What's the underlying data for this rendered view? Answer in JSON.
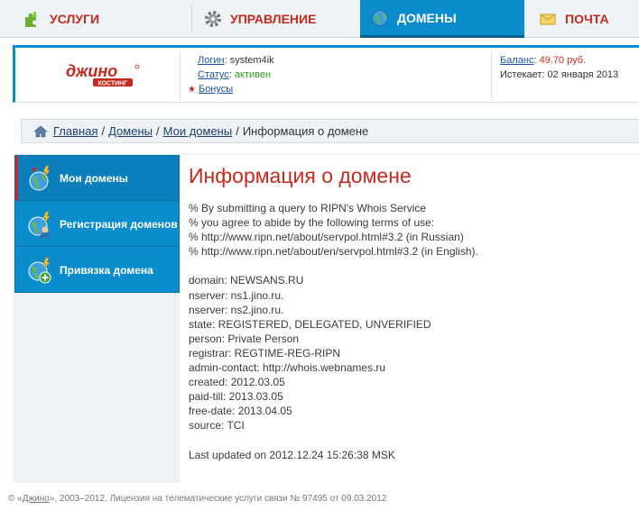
{
  "nav": {
    "tabs": [
      {
        "label": "Услуги",
        "icon": "puzzle-icon"
      },
      {
        "label": "Управление",
        "icon": "gear-icon"
      },
      {
        "label": "Домены",
        "icon": "globe-icon",
        "active": true
      },
      {
        "label": "Почта",
        "icon": "envelope-icon"
      }
    ]
  },
  "account": {
    "logo_text": "джино",
    "logo_sub": "хостинг",
    "login_label": "Логин",
    "login_value": "system4ik",
    "status_label": "Статус",
    "status_value": "активен",
    "bonus_label": "Бонусы",
    "balance_label": "Баланс",
    "balance_value": "49.70 руб.",
    "expires_label": "Истекает:",
    "expires_value": "02 января 2013"
  },
  "breadcrumb": {
    "items": [
      "Главная",
      "Домены",
      "Мои домены"
    ],
    "current": "Информация о домене",
    "separator": "/"
  },
  "sidebar": {
    "items": [
      {
        "label": "Мои домены",
        "icon": "domains-icon",
        "active": true
      },
      {
        "label": "Регистрация доменов",
        "icon": "register-domain-icon"
      },
      {
        "label": "Привязка домена",
        "icon": "bind-domain-icon"
      }
    ]
  },
  "main": {
    "title": "Информация о домене",
    "whois_lines": [
      "% By submitting a query to RIPN's Whois Service",
      "% you agree to abide by the following terms of use:",
      "% http://www.ripn.net/about/servpol.html#3.2 (in Russian)",
      "% http://www.ripn.net/about/en/servpol.html#3.2 (in English).",
      "",
      "domain: NEWSANS.RU",
      "nserver: ns1.jino.ru.",
      "nserver: ns2.jino.ru.",
      "state: REGISTERED, DELEGATED, UNVERIFIED",
      "person: Private Person",
      "registrar: REGTIME-REG-RIPN",
      "admin-contact: http://whois.webnames.ru",
      "created: 2012.03.05",
      "paid-till: 2013.03.05",
      "free-date: 2013.04.05",
      "source: TCI",
      "",
      "Last updated on 2012.12.24 15:26:38 MSK"
    ]
  },
  "footer": {
    "prefix": "© «",
    "brand": "Джино",
    "suffix": "», 2003–2012. Лицензия на телематические услуги связи № 97495 от 09.03.2012"
  },
  "colors": {
    "accent": "#0b8ccc",
    "brand_red": "#c62a1e",
    "status_ok": "#2c9a1d"
  }
}
